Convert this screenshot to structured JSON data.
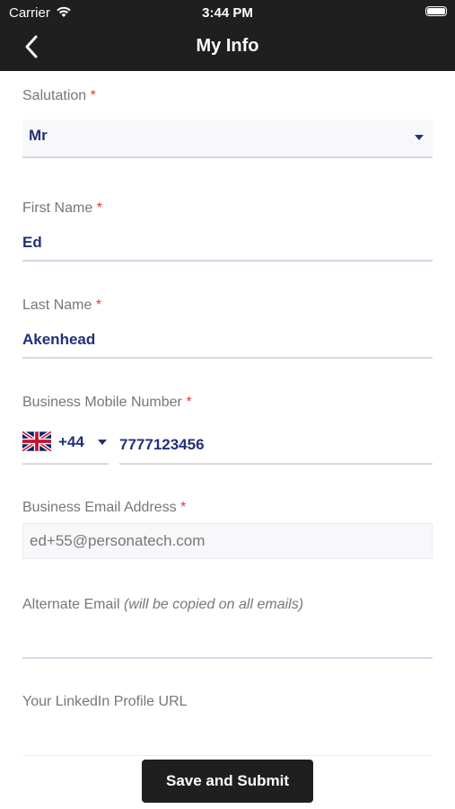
{
  "status": {
    "carrier": "Carrier",
    "time": "3:44 PM"
  },
  "header": {
    "title": "My Info"
  },
  "form": {
    "salutation": {
      "label": "Salutation",
      "value": "Mr"
    },
    "first_name": {
      "label": "First Name",
      "value": "Ed"
    },
    "last_name": {
      "label": "Last Name",
      "value": "Akenhead"
    },
    "mobile": {
      "label": "Business Mobile Number",
      "country_code": "+44",
      "number": "7777123456"
    },
    "email": {
      "label": "Business Email Address",
      "value": "ed+55@personatech.com"
    },
    "alt_email": {
      "label": "Alternate Email",
      "hint": "(will be copied on all emails)",
      "value": ""
    },
    "linkedin": {
      "label": "Your LinkedIn Profile URL",
      "value": ""
    },
    "required_mark": "*"
  },
  "actions": {
    "submit_label": "Save and Submit"
  }
}
